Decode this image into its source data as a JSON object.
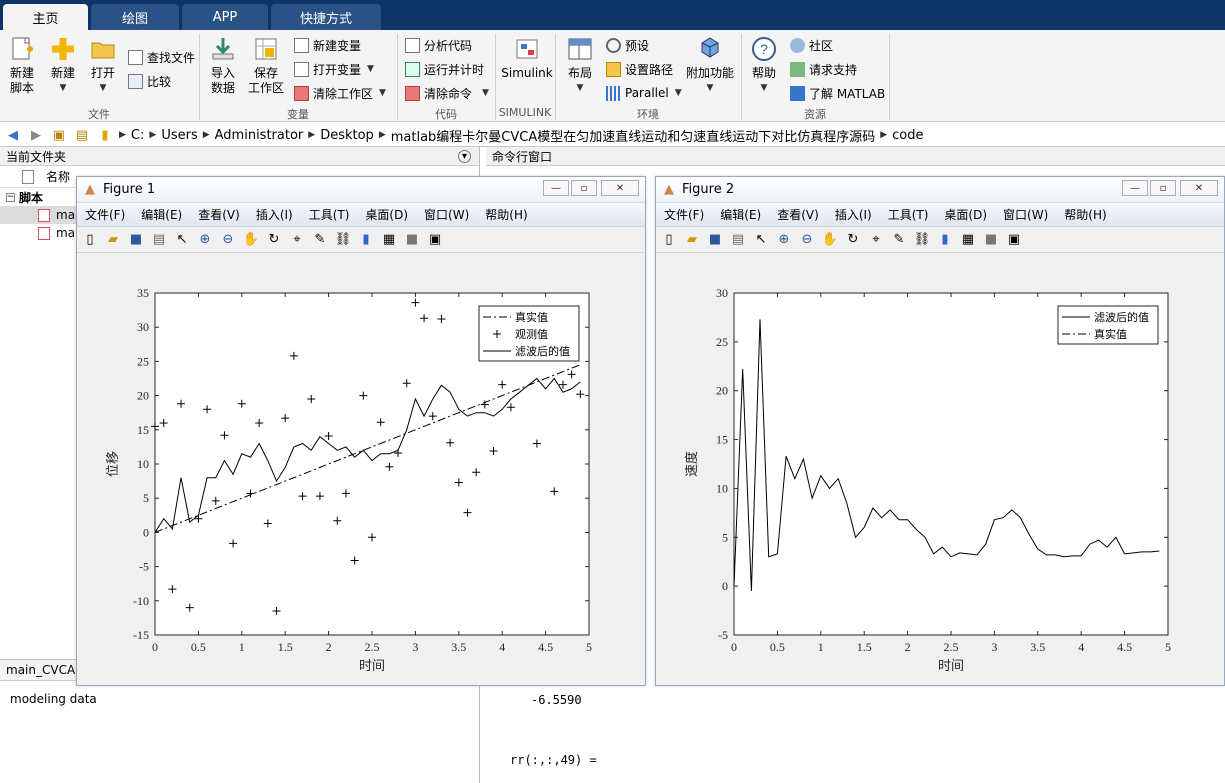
{
  "tabs": [
    "主页",
    "绘图",
    "APP",
    "快捷方式"
  ],
  "ribbon": {
    "new_script": "新建\n脚本",
    "new": "新建",
    "open": "打开",
    "find_files": "查找文件",
    "compare": "比较",
    "import": "导入\n数据",
    "save_ws": "保存\n工作区",
    "new_var": "新建变量",
    "open_var": "打开变量",
    "clear_ws": "清除工作区",
    "analyze": "分析代码",
    "run_time": "运行并计时",
    "clear_cmd": "清除命令",
    "simulink": "Simulink",
    "layout": "布局",
    "prefs": "预设",
    "set_path": "设置路径",
    "parallel": "Parallel",
    "addons": "附加功能",
    "help": "帮助",
    "community": "社区",
    "support": "请求支持",
    "learn": "了解 MATLAB",
    "groups": [
      "文件",
      "变量",
      "代码",
      "SIMULINK",
      "环境",
      "资源"
    ]
  },
  "address": [
    "C:",
    "Users",
    "Administrator",
    "Desktop",
    "matlab编程卡尔曼CVCA模型在匀加速直线运动和匀速直线运动下对比仿真程序源码",
    "code"
  ],
  "left": {
    "title": "当前文件夹",
    "col_name": "名称",
    "section": "脚本",
    "files": [
      "ma",
      "ma"
    ],
    "detail_title": "main_CVCA",
    "detail_text": "modeling data"
  },
  "cmd": {
    "title": "命令行窗口",
    "value": "-6.5590",
    "line": "rr(:,:,49) ="
  },
  "menus": [
    "文件(F)",
    "编辑(E)",
    "查看(V)",
    "插入(I)",
    "工具(T)",
    "桌面(D)",
    "窗口(W)",
    "帮助(H)"
  ],
  "fig1": {
    "title": "Figure 1"
  },
  "fig2": {
    "title": "Figure 2"
  },
  "chart_data": [
    {
      "type": "line",
      "xlabel": "时间",
      "ylabel": "位移",
      "xlim": [
        0,
        5
      ],
      "ylim": [
        -15,
        35
      ],
      "xticks": [
        0,
        0.5,
        1,
        1.5,
        2,
        2.5,
        3,
        3.5,
        4,
        4.5,
        5
      ],
      "yticks": [
        -15,
        -10,
        -5,
        0,
        5,
        10,
        15,
        20,
        25,
        30,
        35
      ],
      "legend": [
        "真实值",
        "观测值",
        "滤波后的值"
      ],
      "legend_position": "top-right",
      "series": [
        {
          "name": "真实值",
          "style": "dashdot",
          "x": [
            0,
            4.9
          ],
          "y": [
            0,
            24.5
          ]
        },
        {
          "name": "观测值",
          "style": "plus",
          "x": [
            0,
            0.1,
            0.2,
            0.3,
            0.4,
            0.5,
            0.6,
            0.7,
            0.8,
            0.9,
            1.0,
            1.1,
            1.2,
            1.3,
            1.4,
            1.5,
            1.6,
            1.7,
            1.8,
            1.9,
            2.0,
            2.1,
            2.2,
            2.3,
            2.4,
            2.5,
            2.6,
            2.7,
            2.8,
            2.9,
            3.0,
            3.1,
            3.2,
            3.3,
            3.4,
            3.5,
            3.6,
            3.7,
            3.8,
            3.9,
            4.0,
            4.1,
            4.4,
            4.6,
            4.7,
            4.8,
            4.9
          ],
          "y": [
            15.5,
            16,
            -8.3,
            18.8,
            -11,
            2,
            18,
            4.6,
            14.2,
            -1.6,
            18.8,
            5.7,
            16,
            1.3,
            -11.5,
            16.7,
            25.8,
            5.3,
            19.5,
            5.3,
            14.1,
            1.7,
            5.7,
            -4.1,
            20,
            -0.7,
            16.1,
            9.6,
            11.6,
            21.8,
            33.6,
            31.3,
            17,
            31.2,
            13.1,
            7.3,
            2.9,
            8.8,
            18.7,
            11.9,
            21.6,
            18.3,
            13,
            6,
            21.6,
            23.1,
            20.2
          ]
        },
        {
          "name": "滤波后的值",
          "style": "solid",
          "x": [
            0,
            0.1,
            0.2,
            0.3,
            0.4,
            0.5,
            0.6,
            0.7,
            0.8,
            0.9,
            1.0,
            1.1,
            1.2,
            1.3,
            1.4,
            1.5,
            1.6,
            1.7,
            1.8,
            1.9,
            2.0,
            2.1,
            2.2,
            2.3,
            2.4,
            2.5,
            2.6,
            2.7,
            2.8,
            2.9,
            3.0,
            3.1,
            3.2,
            3.3,
            3.4,
            3.5,
            3.6,
            3.7,
            3.8,
            3.9,
            4.0,
            4.1,
            4.2,
            4.3,
            4.4,
            4.5,
            4.6,
            4.7,
            4.8,
            4.9
          ],
          "y": [
            0,
            2,
            0.5,
            8,
            1.5,
            2.5,
            8,
            8,
            10.5,
            8.5,
            11.5,
            11,
            13,
            10.5,
            7.5,
            9.5,
            12.5,
            13,
            12,
            14,
            13,
            12,
            12.5,
            11,
            12,
            10.5,
            11.5,
            11.5,
            12,
            15,
            19.5,
            17,
            19.5,
            21.5,
            20.5,
            18,
            17,
            17.5,
            17.5,
            17,
            18,
            19.5,
            20.5,
            21.5,
            22.5,
            21,
            22.5,
            20.5,
            21,
            22
          ]
        }
      ]
    },
    {
      "type": "line",
      "xlabel": "时间",
      "ylabel": "速度",
      "xlim": [
        0,
        5
      ],
      "ylim": [
        -5,
        30
      ],
      "xticks": [
        0,
        0.5,
        1,
        1.5,
        2,
        2.5,
        3,
        3.5,
        4,
        4.5,
        5
      ],
      "yticks": [
        -5,
        0,
        5,
        10,
        15,
        20,
        25,
        30
      ],
      "legend": [
        "滤波后的值",
        "真实值"
      ],
      "legend_position": "top-right",
      "series": [
        {
          "name": "滤波后的值",
          "style": "solid",
          "x": [
            0,
            0.1,
            0.2,
            0.3,
            0.4,
            0.5,
            0.6,
            0.7,
            0.8,
            0.9,
            1.0,
            1.1,
            1.2,
            1.3,
            1.4,
            1.5,
            1.6,
            1.7,
            1.8,
            1.9,
            2.0,
            2.1,
            2.2,
            2.3,
            2.4,
            2.5,
            2.6,
            2.7,
            2.8,
            2.9,
            3.0,
            3.1,
            3.2,
            3.3,
            3.4,
            3.5,
            3.6,
            3.7,
            3.8,
            3.9,
            4.0,
            4.1,
            4.2,
            4.3,
            4.4,
            4.5,
            4.6,
            4.7,
            4.8,
            4.9
          ],
          "y": [
            0,
            22.2,
            -0.5,
            27.3,
            3,
            3.3,
            13.3,
            11,
            13,
            9,
            11.3,
            10,
            11,
            8.5,
            5,
            6,
            8,
            7,
            7.8,
            6.8,
            6.8,
            5.8,
            5,
            3.3,
            4,
            3,
            3.4,
            3.3,
            3.2,
            4.3,
            6.8,
            7,
            7.8,
            7,
            5.3,
            3.8,
            3.2,
            3.2,
            3,
            3.1,
            3.1,
            4.3,
            4.7,
            4,
            5,
            3.3,
            3.4,
            3.5,
            3.5,
            3.6
          ]
        },
        {
          "name": "真实值",
          "style": "dashdot",
          "x": [],
          "y": []
        }
      ]
    }
  ]
}
